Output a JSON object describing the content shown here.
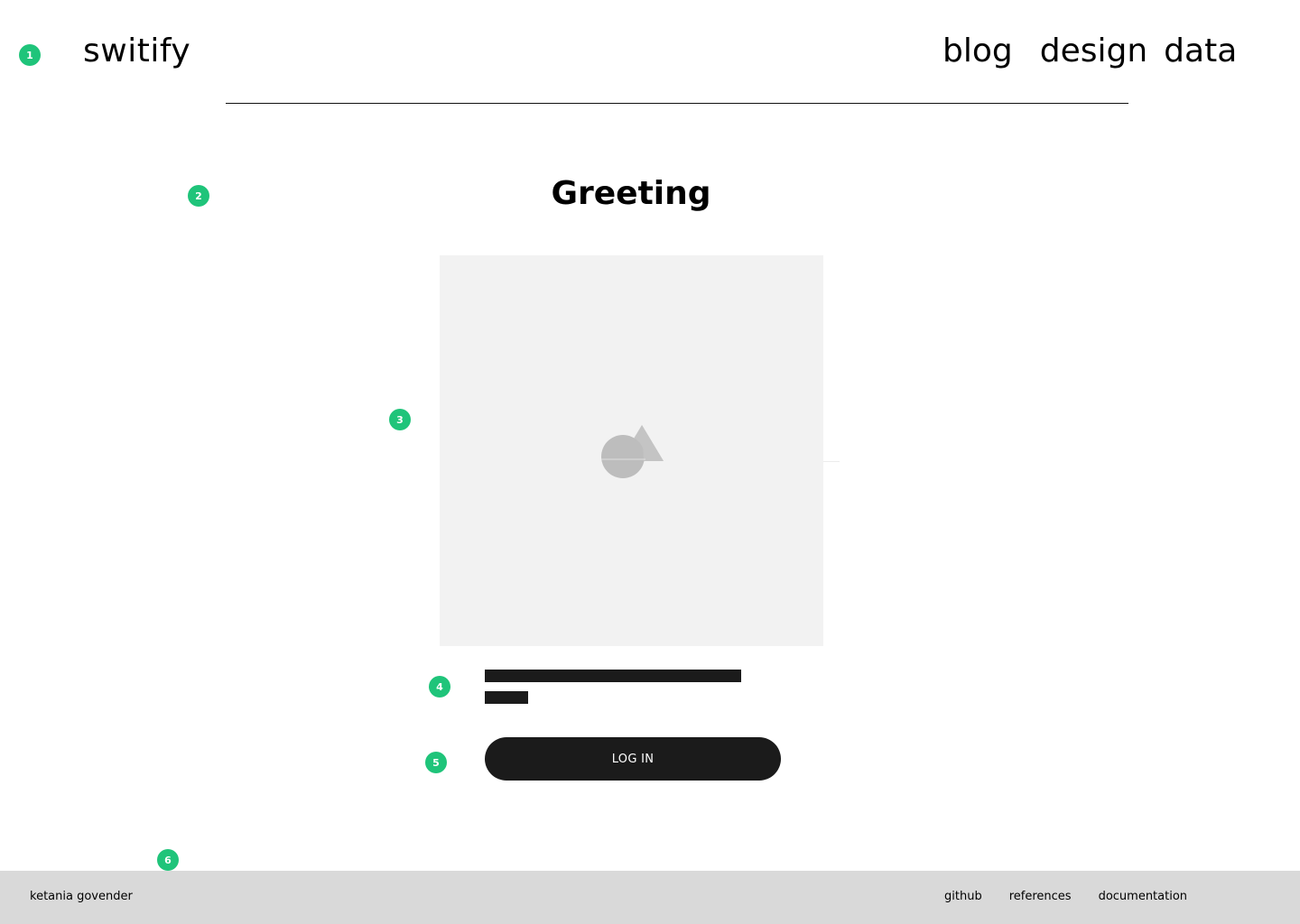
{
  "markers": [
    "1",
    "2",
    "3",
    "4",
    "5",
    "6"
  ],
  "header": {
    "brand": "switify",
    "nav": [
      "blog",
      "design",
      "data"
    ]
  },
  "main": {
    "title": "Greeting",
    "image_placeholder_icon": "image-placeholder-icon",
    "login_label": "LOG IN"
  },
  "footer": {
    "author": "ketania govender",
    "links": [
      "github",
      "references",
      "documentation"
    ]
  },
  "colors": {
    "marker": "#1fc47a",
    "button": "#1b1b1b",
    "placeholder_bg": "#f2f2f2",
    "footer_bg": "#d9d9d9"
  }
}
